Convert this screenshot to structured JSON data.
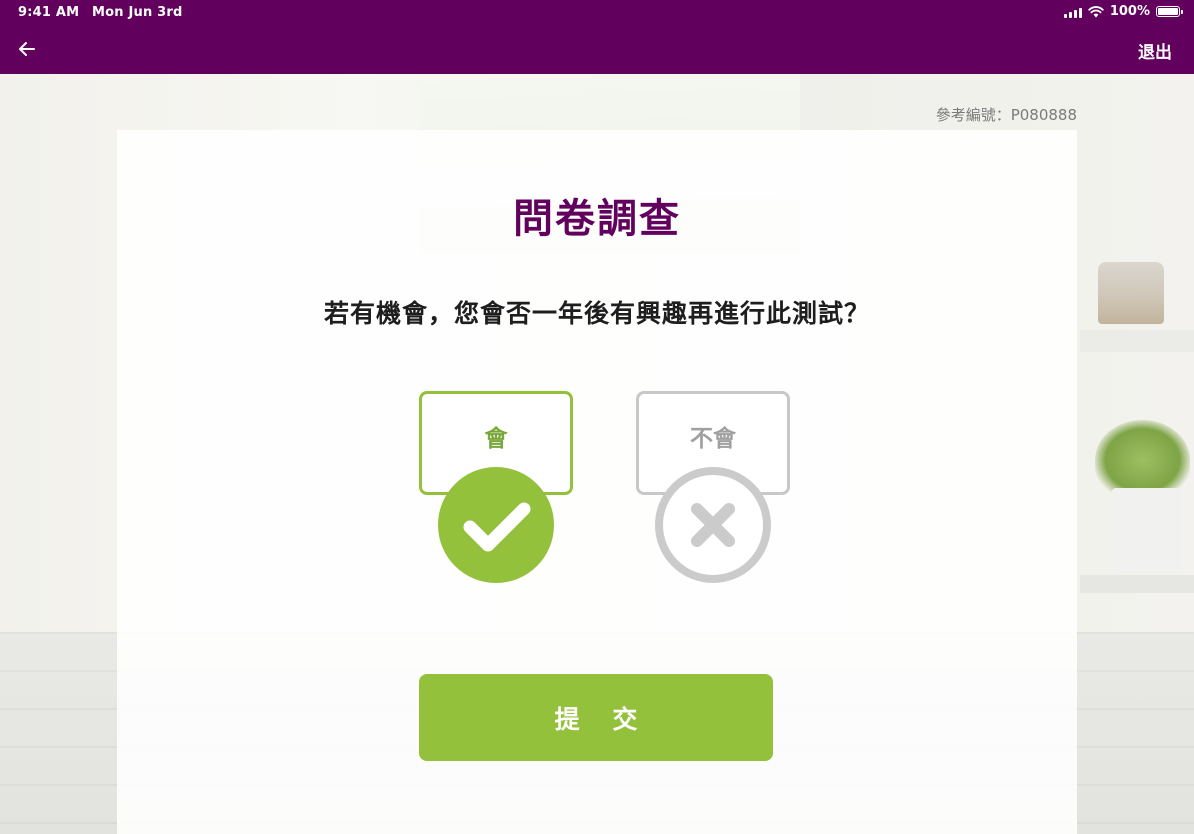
{
  "status_bar": {
    "time": "9:41 AM",
    "date": "Mon Jun 3rd",
    "battery": "100%"
  },
  "nav": {
    "back_icon": "arrow-left-icon",
    "exit_label": "退出"
  },
  "reference": "參考編號：P080888",
  "title": "問卷調查",
  "question": "若有機會，您會否一年後有興趣再進行此測試？",
  "options": [
    {
      "label": "會",
      "icon": "check-icon",
      "selected": true
    },
    {
      "label": "不會",
      "icon": "cross-icon",
      "selected": false
    }
  ],
  "submit_label": "提 交",
  "colors": {
    "brand": "#62005e",
    "accent": "#93c13b",
    "inactive": "#cbcbcb"
  }
}
